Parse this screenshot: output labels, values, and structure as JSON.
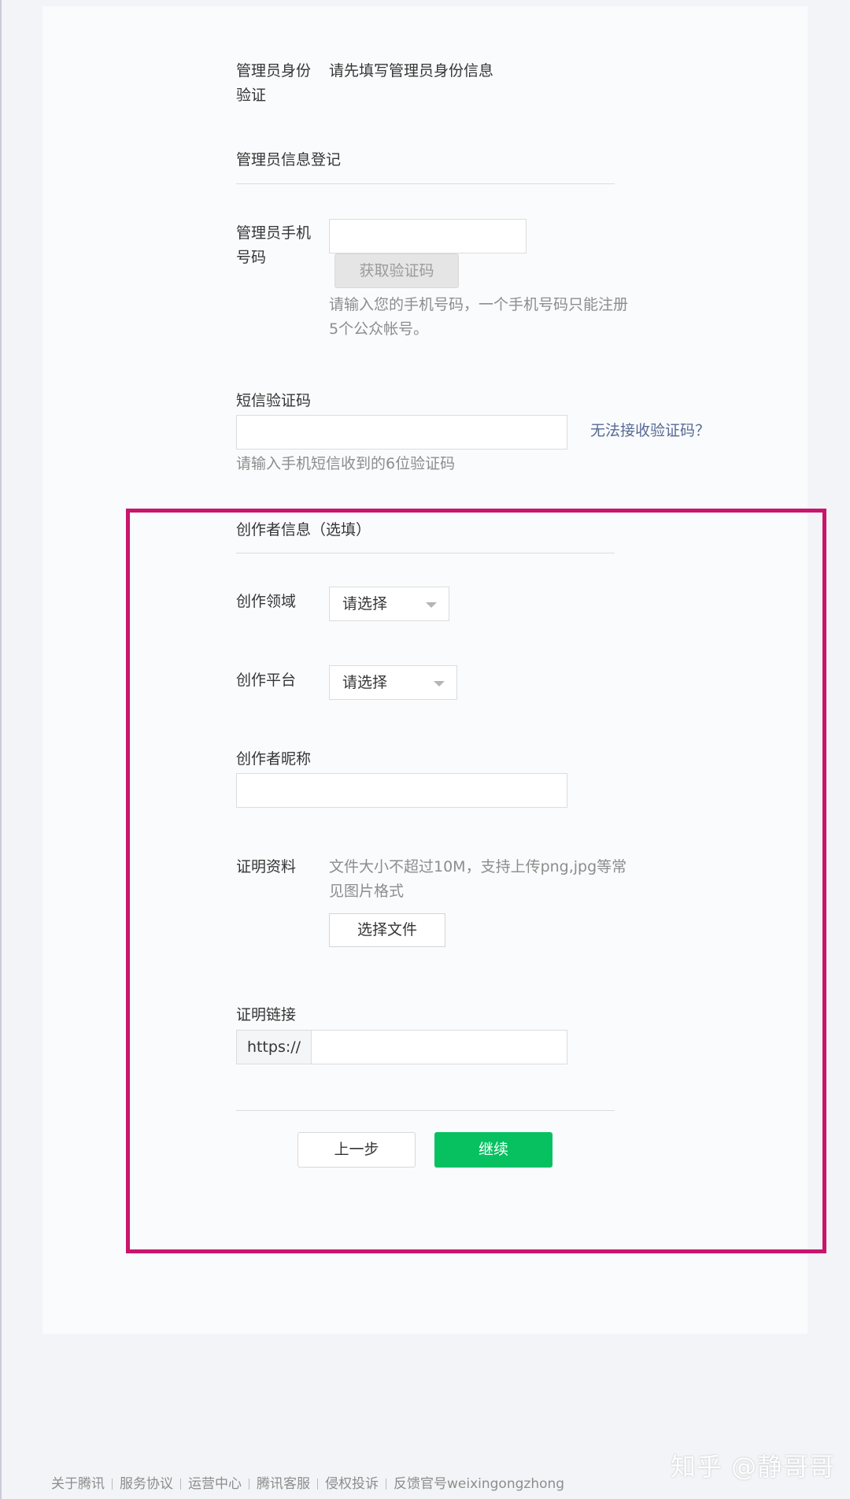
{
  "admin_verify": {
    "label": "管理员身份验证",
    "value": "请先填写管理员身份信息"
  },
  "admin_section": {
    "title": "管理员信息登记"
  },
  "phone": {
    "label": "管理员手机号码",
    "value": "",
    "get_code_button": "获取验证码",
    "hint": "请输入您的手机号码，一个手机号码只能注册5个公众帐号。"
  },
  "sms": {
    "label": "短信验证码",
    "value": "",
    "cannot_receive_link": "无法接收验证码？",
    "hint": "请输入手机短信收到的6位验证码"
  },
  "creator_section": {
    "title": "创作者信息（选填）"
  },
  "creator_field": {
    "label": "创作领域",
    "selected": "请选择"
  },
  "creator_platform": {
    "label": "创作平台",
    "selected": "请选择"
  },
  "creator_nickname": {
    "label": "创作者昵称",
    "value": ""
  },
  "proof_material": {
    "label": "证明资料",
    "hint": "文件大小不超过10M，支持上传png,jpg等常见图片格式",
    "choose_file_button": "选择文件"
  },
  "proof_link": {
    "label": "证明链接",
    "prefix": "https://",
    "value": ""
  },
  "actions": {
    "prev": "上一步",
    "next": "继续"
  },
  "footer": {
    "links": [
      "关于腾讯",
      "服务协议",
      "运营中心",
      "腾讯客服",
      "侵权投诉",
      "反馈官号weixingongzhong"
    ]
  },
  "watermark": "知乎 @静哥哥",
  "colors": {
    "primary": "#07c160",
    "link": "#576b95",
    "highlight": "#c8156e"
  }
}
